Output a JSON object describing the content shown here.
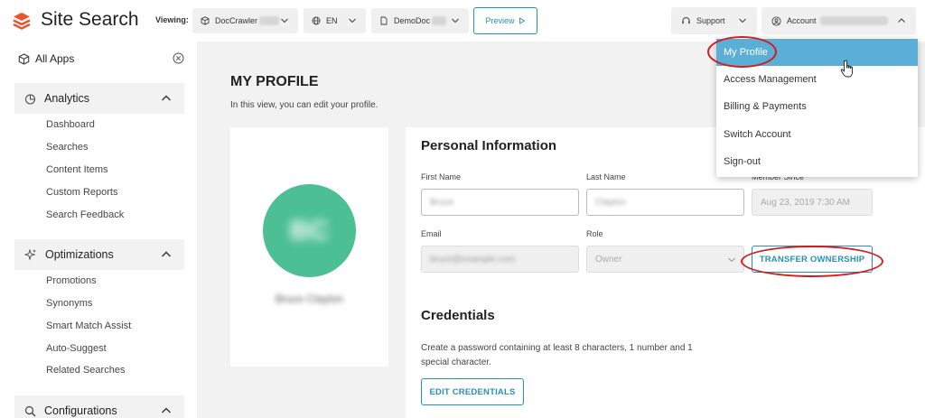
{
  "header": {
    "app_title": "Site Search",
    "viewing_label": "Viewing:",
    "app_selector": {
      "label": "DocCrawler",
      "icon": "cube-icon"
    },
    "language_selector": {
      "label": "EN",
      "icon": "globe-icon"
    },
    "doc_selector": {
      "label": "DemoDoc",
      "icon": "document-icon"
    },
    "preview_label": "Preview",
    "support_label": "Support",
    "account_label": "Account"
  },
  "account_menu": {
    "items": [
      {
        "label": "My Profile",
        "active": true
      },
      {
        "label": "Access Management"
      },
      {
        "label": "Billing & Payments"
      },
      {
        "label": "Switch Account"
      },
      {
        "label": "Sign-out"
      }
    ]
  },
  "sidebar": {
    "all_apps": "All Apps",
    "sections": [
      {
        "label": "Analytics",
        "icon": "pie-chart-icon",
        "items": [
          "Dashboard",
          "Searches",
          "Content Items",
          "Custom Reports",
          "Search Feedback"
        ]
      },
      {
        "label": "Optimizations",
        "icon": "sparkle-icon",
        "items": [
          "Promotions",
          "Synonyms",
          "Smart Match Assist",
          "Auto-Suggest",
          "Related Searches"
        ]
      },
      {
        "label": "Configurations",
        "icon": "search-icon",
        "items": []
      }
    ]
  },
  "main": {
    "title": "MY PROFILE",
    "subtitle": "In this view, you can edit your profile.",
    "avatar_initials": "BC",
    "avatar_name": "Bruce Clayton",
    "personal_info": {
      "heading": "Personal Information",
      "first_name_label": "First Name",
      "first_name_value": "Bruce",
      "last_name_label": "Last Name",
      "last_name_value": "Clayton",
      "member_since_label": "Member Since",
      "member_since_value": "Aug 23, 2019 7:30 AM",
      "email_label": "Email",
      "email_value": "bruce@example.com",
      "role_label": "Role",
      "role_value": "Owner",
      "transfer_label": "TRANSFER OWNERSHIP"
    },
    "credentials": {
      "heading": "Credentials",
      "text": "Create a password containing at least 8 characters, 1 number and 1 special character.",
      "edit_label": "EDIT CREDENTIALS"
    }
  },
  "colors": {
    "accent": "#2a8fb8",
    "logo": "#e8542a",
    "avatar": "#4cbf94",
    "menu_active": "#5bafd6",
    "annotation": "#d61a1a"
  }
}
